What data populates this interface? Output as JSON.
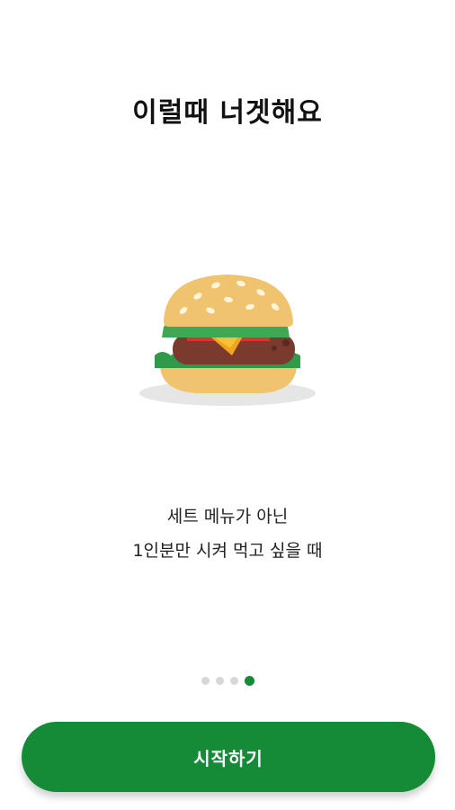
{
  "onboarding": {
    "title": "이럴때 너겟해요",
    "description_line1": "세트 메뉴가 아닌",
    "description_line2": "1인분만 시켜 먹고 싶을 때",
    "illustration_icon": "burger-icon",
    "pager": {
      "total_pages": 4,
      "current_page": 4
    }
  },
  "start_button": {
    "label": "시작하기"
  },
  "colors": {
    "accent": "#158a37",
    "dot_inactive": "#d7d7d7",
    "background": "#ffffff"
  }
}
